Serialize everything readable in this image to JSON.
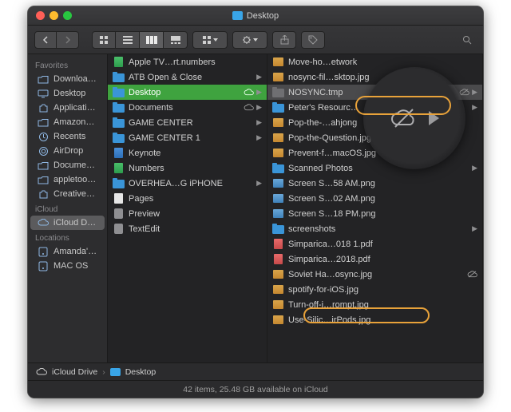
{
  "window": {
    "title": "Desktop"
  },
  "toolbar": {
    "search_placeholder": "Search"
  },
  "sidebar": {
    "sections": [
      {
        "header": "Favorites",
        "items": [
          {
            "icon": "folder",
            "label": "Downloa…"
          },
          {
            "icon": "desktop",
            "label": "Desktop"
          },
          {
            "icon": "app",
            "label": "Applicati…"
          },
          {
            "icon": "folder",
            "label": "Amazon…"
          },
          {
            "icon": "clock",
            "label": "Recents"
          },
          {
            "icon": "airdrop",
            "label": "AirDrop"
          },
          {
            "icon": "folder",
            "label": "Docume…"
          },
          {
            "icon": "folder",
            "label": "appletoo…"
          },
          {
            "icon": "app",
            "label": "Creative…"
          }
        ]
      },
      {
        "header": "iCloud",
        "items": [
          {
            "icon": "cloud",
            "label": "iCloud D…",
            "selected": true
          }
        ]
      },
      {
        "header": "Locations",
        "items": [
          {
            "icon": "disk",
            "label": "Amanda'…"
          },
          {
            "icon": "disk",
            "label": "MAC OS"
          }
        ]
      }
    ]
  },
  "col1": [
    {
      "type": "num",
      "label": "Apple TV…rt.numbers"
    },
    {
      "type": "folder",
      "label": "ATB Open & Close",
      "chev": true
    },
    {
      "type": "folder",
      "label": "Desktop",
      "selected": true,
      "cloud": true,
      "chev": true
    },
    {
      "type": "folder",
      "label": "Documents",
      "cloud": true,
      "chev": true
    },
    {
      "type": "folder",
      "label": "GAME CENTER",
      "chev": true
    },
    {
      "type": "folder",
      "label": "GAME CENTER 1",
      "chev": true
    },
    {
      "type": "key",
      "label": "Keynote"
    },
    {
      "type": "num",
      "label": "Numbers"
    },
    {
      "type": "folder",
      "label": "OVERHEA…G iPHONE",
      "chev": true
    },
    {
      "type": "doc",
      "label": "Pages"
    },
    {
      "type": "app",
      "label": "Preview"
    },
    {
      "type": "app",
      "label": "TextEdit"
    }
  ],
  "col2": [
    {
      "type": "jpg",
      "label": "Move-ho…etwork"
    },
    {
      "type": "jpg",
      "label": "nosync-fil…sktop.jpg"
    },
    {
      "type": "sys",
      "label": "NOSYNC.tmp",
      "sel2": true,
      "nos": true,
      "chev": true
    },
    {
      "type": "folder",
      "label": "Peter's Resourc…",
      "chev": true
    },
    {
      "type": "jpg",
      "label": "Pop-the-…ahjong"
    },
    {
      "type": "jpg",
      "label": "Pop-the-Question.jpg"
    },
    {
      "type": "jpg",
      "label": "Prevent-f…macOS.jpg"
    },
    {
      "type": "folder",
      "label": "Scanned Photos",
      "chev": true
    },
    {
      "type": "png",
      "label": "Screen S…58 AM.png"
    },
    {
      "type": "png",
      "label": "Screen S…02 AM.png"
    },
    {
      "type": "png",
      "label": "Screen S…18 PM.png"
    },
    {
      "type": "folder",
      "label": "screenshots",
      "chev": true
    },
    {
      "type": "pdf",
      "label": "Simparica…018 1.pdf"
    },
    {
      "type": "pdf",
      "label": "Simparica…2018.pdf"
    },
    {
      "type": "jpg",
      "label": "Soviet Ha…osync.jpg",
      "nos": true
    },
    {
      "type": "jpg",
      "label": "spotify-for-iOS.jpg"
    },
    {
      "type": "jpg",
      "label": "Turn-off-i…rompt.jpg"
    },
    {
      "type": "jpg",
      "label": "Use-Silic…irPods.jpg"
    }
  ],
  "path": {
    "a": "iCloud Drive",
    "b": "Desktop"
  },
  "status": "42 items, 25.48 GB available on iCloud"
}
